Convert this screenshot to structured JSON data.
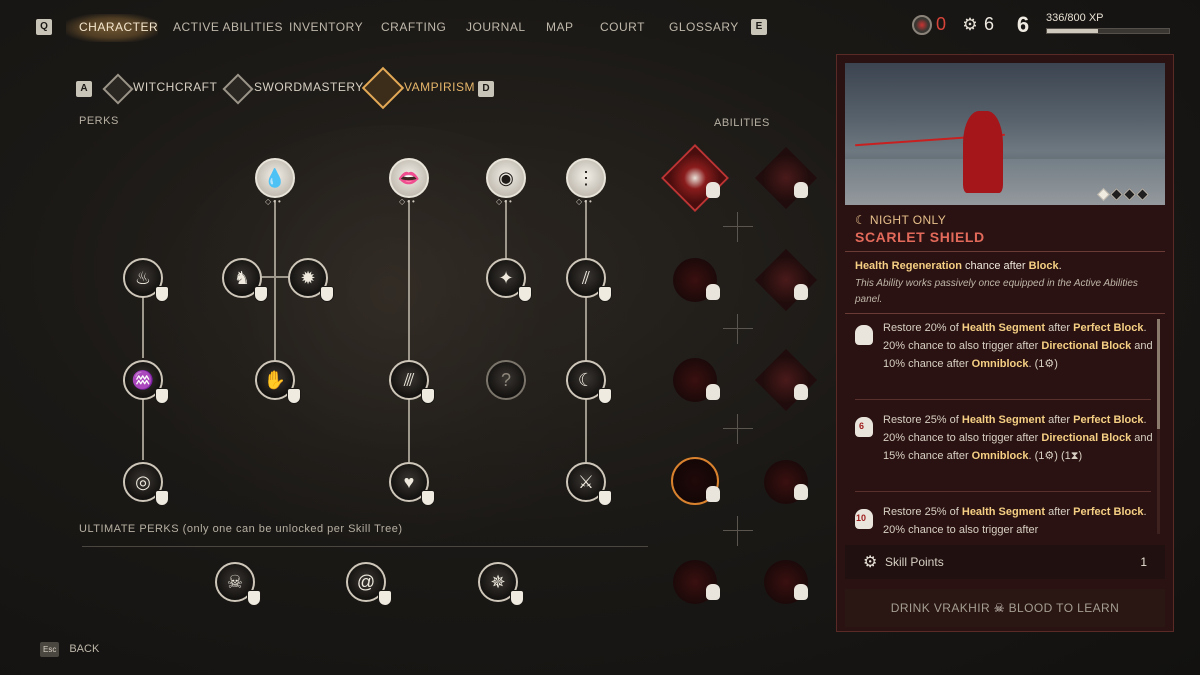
{
  "topbar": {
    "left_key": "Q",
    "right_key": "E",
    "tabs": [
      "CHARACTER",
      "ACTIVE ABILITIES",
      "INVENTORY",
      "CRAFTING",
      "JOURNAL",
      "MAP",
      "COURT",
      "GLOSSARY"
    ],
    "active_tab": "CHARACTER",
    "resource_blood": "0",
    "resource_gear": "6",
    "level": "6",
    "xp_text": "336/800 XP",
    "xp_fraction": 0.42
  },
  "tree_tabs": {
    "left_key": "A",
    "right_key": "D",
    "items": [
      "WITCHCRAFT",
      "SWORDMASTERY",
      "VAMPIRISM"
    ],
    "active": "VAMPIRISM"
  },
  "labels": {
    "perks": "PERKS",
    "abilities": "ABILITIES",
    "ultimate": "ULTIMATE PERKS (only one can be unlocked per Skill Tree)"
  },
  "nodes": {
    "locked_glyph": "?"
  },
  "detail": {
    "tag": "☾ NIGHT ONLY",
    "title": "SCARLET SHIELD",
    "description_parts": [
      "Health Regeneration",
      " chance after ",
      "Block",
      "."
    ],
    "sub_description": "This Ability works passively once equipped in the Active Abilities panel.",
    "tiers": [
      {
        "badge": "",
        "parts": [
          "Restore 20% of ",
          "Health Segment",
          " after ",
          "Perfect Block",
          ". 20% chance to also trigger after ",
          "Directional Block",
          " and 10% chance after ",
          "Omniblock",
          ". (1",
          "⚙",
          ")"
        ]
      },
      {
        "badge": "6",
        "parts": [
          "Restore 25% of ",
          "Health Segment",
          " after ",
          "Perfect Block",
          ". 20% chance to also trigger after ",
          "Directional Block",
          " and 15% chance after ",
          "Omniblock",
          ". (1",
          "⚙",
          ") (1",
          "⧗",
          ")"
        ]
      },
      {
        "badge": "10",
        "parts": [
          "Restore 25% of ",
          "Health Segment",
          " after ",
          "Perfect Block",
          ". 20% chance to also trigger after"
        ]
      }
    ],
    "skill_points_label": "Skill Points",
    "skill_points_value": "1",
    "learn_prefix": "DRINK VRAKHIR",
    "learn_suffix": "BLOOD TO LEARN"
  },
  "footer": {
    "key": "Esc",
    "label": "BACK"
  }
}
